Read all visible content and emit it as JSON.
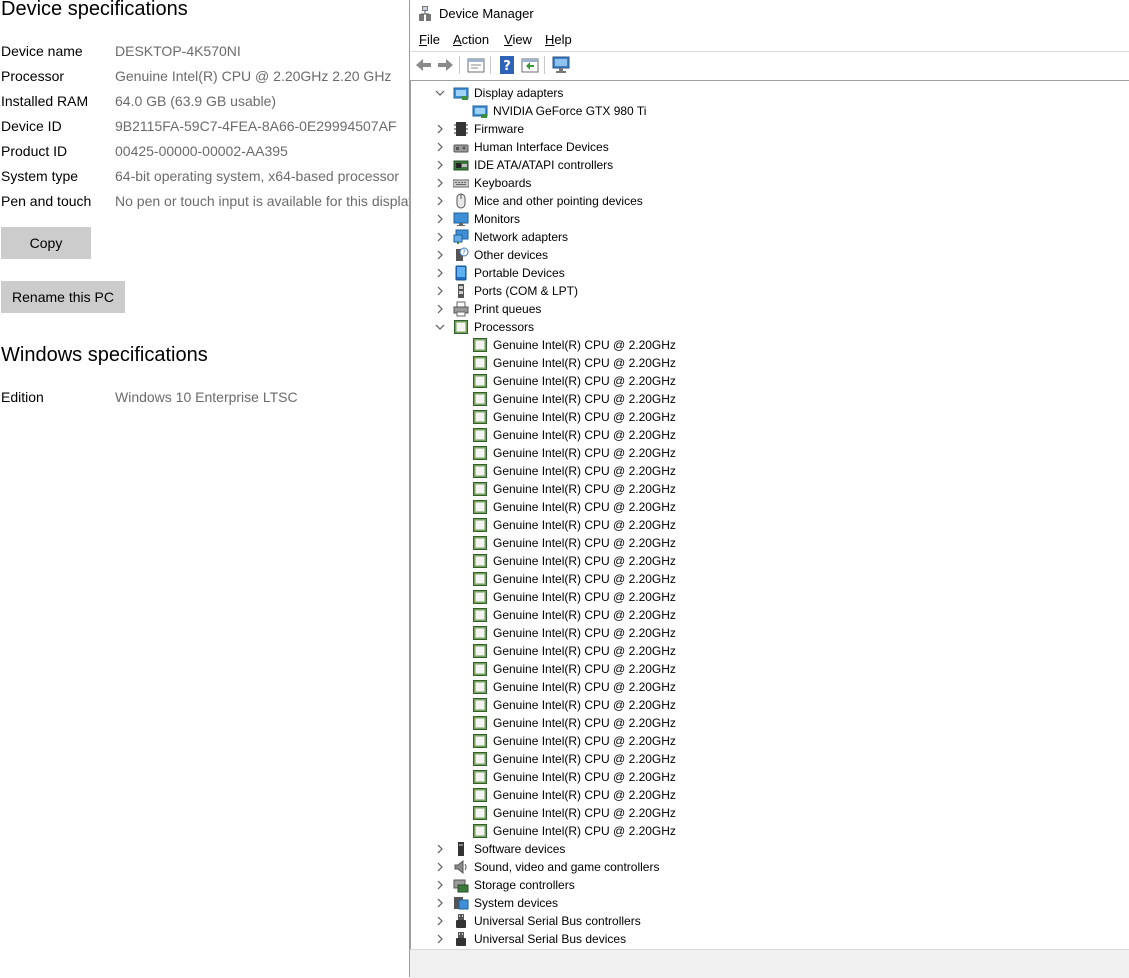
{
  "settings": {
    "device_specs_title": "Device specifications",
    "specs": [
      {
        "label": "Device name",
        "value": "DESKTOP-4K570NI"
      },
      {
        "label": "Processor",
        "value": "Genuine Intel(R) CPU @ 2.20GHz   2.20 GHz"
      },
      {
        "label": "Installed RAM",
        "value": "64.0 GB (63.9 GB usable)"
      },
      {
        "label": "Device ID",
        "value": "9B2115FA-59C7-4FEA-8A66-0E29994507AF"
      },
      {
        "label": "Product ID",
        "value": "00425-00000-00002-AA395"
      },
      {
        "label": "System type",
        "value": "64-bit operating system, x64-based processor"
      },
      {
        "label": "Pen and touch",
        "value": "No pen or touch input is available for this display"
      }
    ],
    "copy_button": "Copy",
    "rename_button": "Rename this PC",
    "windows_specs_title": "Windows specifications",
    "edition_label": "Edition",
    "edition_value": "Windows 10 Enterprise LTSC"
  },
  "device_manager": {
    "title": "Device Manager",
    "menu": [
      {
        "accel": "F",
        "rest": "ile"
      },
      {
        "accel": "A",
        "rest": "ction"
      },
      {
        "accel": "V",
        "rest": "iew"
      },
      {
        "accel": "H",
        "rest": "elp"
      }
    ],
    "toolbar_icons": [
      "back-arrow-icon",
      "forward-arrow-icon",
      "properties-icon",
      "help-icon",
      "update-driver-icon",
      "scan-hardware-icon"
    ],
    "tree": [
      {
        "label": "Display adapters",
        "expanded": true,
        "icon": "display-adapter-icon",
        "children": [
          {
            "label": "NVIDIA GeForce GTX 980 Ti",
            "icon": "display-adapter-icon"
          }
        ]
      },
      {
        "label": "Firmware",
        "expanded": false,
        "icon": "firmware-icon"
      },
      {
        "label": "Human Interface Devices",
        "expanded": false,
        "icon": "hid-icon"
      },
      {
        "label": "IDE ATA/ATAPI controllers",
        "expanded": false,
        "icon": "ide-controller-icon"
      },
      {
        "label": "Keyboards",
        "expanded": false,
        "icon": "keyboard-icon"
      },
      {
        "label": "Mice and other pointing devices",
        "expanded": false,
        "icon": "mouse-icon"
      },
      {
        "label": "Monitors",
        "expanded": false,
        "icon": "monitor-icon"
      },
      {
        "label": "Network adapters",
        "expanded": false,
        "icon": "network-adapter-icon"
      },
      {
        "label": "Other devices",
        "expanded": false,
        "icon": "unknown-device-icon"
      },
      {
        "label": "Portable Devices",
        "expanded": false,
        "icon": "portable-device-icon"
      },
      {
        "label": "Ports (COM & LPT)",
        "expanded": false,
        "icon": "port-icon"
      },
      {
        "label": "Print queues",
        "expanded": false,
        "icon": "printer-icon"
      },
      {
        "label": "Processors",
        "expanded": true,
        "icon": "processor-icon",
        "children": [
          {
            "label": "Genuine Intel(R) CPU @ 2.20GHz",
            "icon": "processor-icon"
          },
          {
            "label": "Genuine Intel(R) CPU @ 2.20GHz",
            "icon": "processor-icon"
          },
          {
            "label": "Genuine Intel(R) CPU @ 2.20GHz",
            "icon": "processor-icon"
          },
          {
            "label": "Genuine Intel(R) CPU @ 2.20GHz",
            "icon": "processor-icon"
          },
          {
            "label": "Genuine Intel(R) CPU @ 2.20GHz",
            "icon": "processor-icon"
          },
          {
            "label": "Genuine Intel(R) CPU @ 2.20GHz",
            "icon": "processor-icon"
          },
          {
            "label": "Genuine Intel(R) CPU @ 2.20GHz",
            "icon": "processor-icon"
          },
          {
            "label": "Genuine Intel(R) CPU @ 2.20GHz",
            "icon": "processor-icon"
          },
          {
            "label": "Genuine Intel(R) CPU @ 2.20GHz",
            "icon": "processor-icon"
          },
          {
            "label": "Genuine Intel(R) CPU @ 2.20GHz",
            "icon": "processor-icon"
          },
          {
            "label": "Genuine Intel(R) CPU @ 2.20GHz",
            "icon": "processor-icon"
          },
          {
            "label": "Genuine Intel(R) CPU @ 2.20GHz",
            "icon": "processor-icon"
          },
          {
            "label": "Genuine Intel(R) CPU @ 2.20GHz",
            "icon": "processor-icon"
          },
          {
            "label": "Genuine Intel(R) CPU @ 2.20GHz",
            "icon": "processor-icon"
          },
          {
            "label": "Genuine Intel(R) CPU @ 2.20GHz",
            "icon": "processor-icon"
          },
          {
            "label": "Genuine Intel(R) CPU @ 2.20GHz",
            "icon": "processor-icon"
          },
          {
            "label": "Genuine Intel(R) CPU @ 2.20GHz",
            "icon": "processor-icon"
          },
          {
            "label": "Genuine Intel(R) CPU @ 2.20GHz",
            "icon": "processor-icon"
          },
          {
            "label": "Genuine Intel(R) CPU @ 2.20GHz",
            "icon": "processor-icon"
          },
          {
            "label": "Genuine Intel(R) CPU @ 2.20GHz",
            "icon": "processor-icon"
          },
          {
            "label": "Genuine Intel(R) CPU @ 2.20GHz",
            "icon": "processor-icon"
          },
          {
            "label": "Genuine Intel(R) CPU @ 2.20GHz",
            "icon": "processor-icon"
          },
          {
            "label": "Genuine Intel(R) CPU @ 2.20GHz",
            "icon": "processor-icon"
          },
          {
            "label": "Genuine Intel(R) CPU @ 2.20GHz",
            "icon": "processor-icon"
          },
          {
            "label": "Genuine Intel(R) CPU @ 2.20GHz",
            "icon": "processor-icon"
          },
          {
            "label": "Genuine Intel(R) CPU @ 2.20GHz",
            "icon": "processor-icon"
          },
          {
            "label": "Genuine Intel(R) CPU @ 2.20GHz",
            "icon": "processor-icon"
          },
          {
            "label": "Genuine Intel(R) CPU @ 2.20GHz",
            "icon": "processor-icon"
          }
        ]
      },
      {
        "label": "Software devices",
        "expanded": false,
        "icon": "software-device-icon"
      },
      {
        "label": "Sound, video and game controllers",
        "expanded": false,
        "icon": "sound-icon"
      },
      {
        "label": "Storage controllers",
        "expanded": false,
        "icon": "storage-controller-icon"
      },
      {
        "label": "System devices",
        "expanded": false,
        "icon": "system-device-icon"
      },
      {
        "label": "Universal Serial Bus controllers",
        "expanded": false,
        "icon": "usb-icon"
      },
      {
        "label": "Universal Serial Bus devices",
        "expanded": false,
        "icon": "usb-icon"
      }
    ]
  }
}
